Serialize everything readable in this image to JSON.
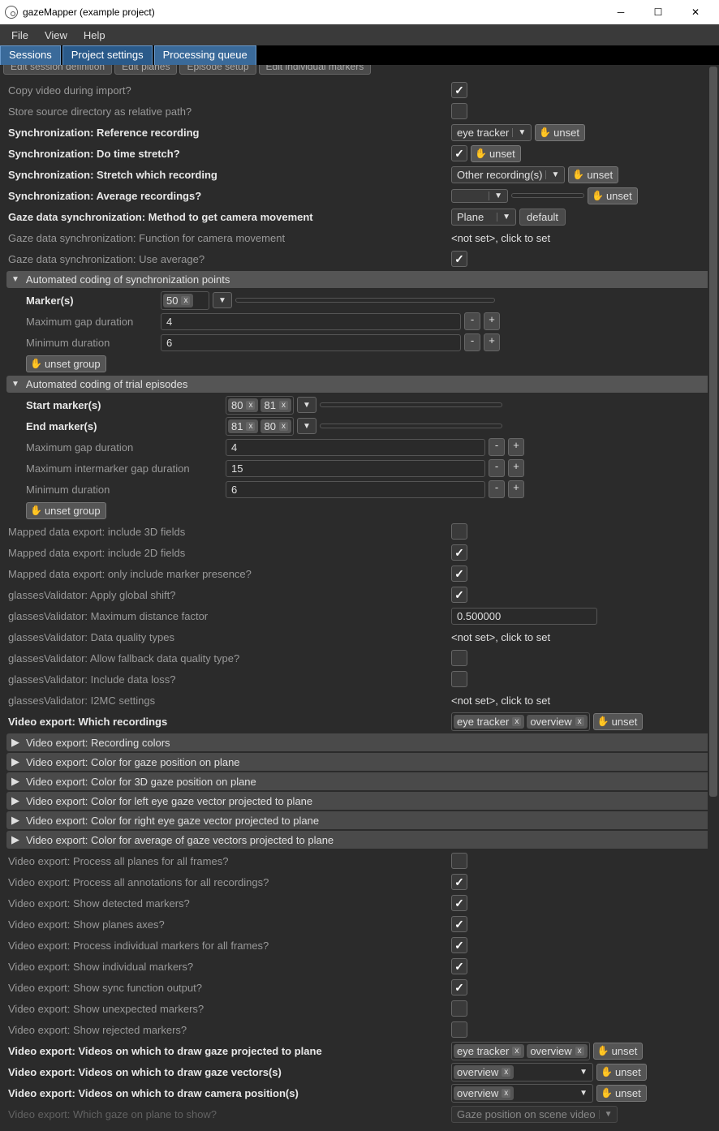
{
  "titlebar": {
    "title": "gazeMapper (example project)"
  },
  "menubar": {
    "file": "File",
    "view": "View",
    "help": "Help"
  },
  "tabs": {
    "sessions": "Sessions",
    "project": "Project settings",
    "queue": "Processing queue"
  },
  "subtabs": [
    "Edit session definition",
    "Edit planes",
    "Episode setup",
    "Edit individual markers"
  ],
  "settings": {
    "copy_video": "Copy video during import?",
    "store_src": "Store source directory as relative path?",
    "sync_ref": "Synchronization: Reference recording",
    "sync_ref_val": "eye tracker",
    "sync_stretch": "Synchronization: Do time stretch?",
    "sync_which": "Synchronization: Stretch which recording",
    "sync_which_val": "Other recording(s)",
    "sync_avg": "Synchronization: Average recordings?",
    "gaze_method": "Gaze data synchronization: Method to get camera movement",
    "gaze_method_val": "Plane",
    "gaze_func": "Gaze data synchronization: Function for camera movement",
    "gaze_avg": "Gaze data synchronization: Use average?",
    "notset": "<not set>, click to set",
    "default": "default",
    "unset": "unset",
    "unset_group": "unset group"
  },
  "sync_points": {
    "title": "Automated coding of synchronization points",
    "markers": "Marker(s)",
    "markers_chips": [
      "50"
    ],
    "max_gap": "Maximum gap duration",
    "max_gap_v": "4",
    "min_dur": "Minimum duration",
    "min_dur_v": "6"
  },
  "trial": {
    "title": "Automated coding of trial episodes",
    "start": "Start marker(s)",
    "start_chips": [
      "80",
      "81"
    ],
    "end": "End marker(s)",
    "end_chips": [
      "81",
      "80"
    ],
    "max_gap": "Maximum gap duration",
    "max_gap_v": "4",
    "max_inter": "Maximum intermarker gap duration",
    "max_inter_v": "15",
    "min_dur": "Minimum duration",
    "min_dur_v": "6"
  },
  "export": {
    "inc3d": "Mapped data export: include 3D fields",
    "inc2d": "Mapped data export: include 2D fields",
    "marker": "Mapped data export: only include marker presence?"
  },
  "gv": {
    "shift": "glassesValidator: Apply global shift?",
    "dist": "glassesValidator: Maximum distance factor",
    "dist_v": "0.500000",
    "dq": "glassesValidator: Data quality types",
    "fallback": "glassesValidator: Allow fallback data quality type?",
    "loss": "glassesValidator: Include data loss?",
    "i2mc": "glassesValidator: I2MC settings"
  },
  "video": {
    "which": "Video export: Which recordings",
    "which_chips": [
      "eye tracker",
      "overview"
    ],
    "c1": "Video export: Recording colors",
    "c2": "Video export: Color for gaze position on plane",
    "c3": "Video export: Color for 3D gaze position on plane",
    "c4": "Video export: Color for left eye gaze vector projected to plane",
    "c5": "Video export: Color for right eye gaze vector projected to plane",
    "c6": "Video export: Color for average of gaze vectors projected to plane",
    "p_all_planes": "Video export: Process all planes for all frames?",
    "p_all_ann": "Video export: Process all annotations for all recordings?",
    "show_markers": "Video export: Show detected markers?",
    "show_axes": "Video export: Show planes axes?",
    "p_indiv": "Video export: Process individual markers for all frames?",
    "show_indiv": "Video export: Show individual markers?",
    "show_sync": "Video export: Show sync function output?",
    "show_unexp": "Video export: Show unexpected markers?",
    "show_rej": "Video export: Show rejected markers?",
    "draw_gaze": "Video export: Videos on which to draw gaze projected to plane",
    "draw_gaze_chips": [
      "eye tracker",
      "overview"
    ],
    "draw_vec": "Video export: Videos on which to draw gaze vectors(s)",
    "draw_vec_chips": [
      "overview"
    ],
    "draw_cam": "Video export: Videos on which to draw camera position(s)",
    "draw_cam_chips": [
      "overview"
    ],
    "which_plane": "Video export: Which gaze on plane to show?",
    "which_plane_val": "Gaze position on scene video"
  }
}
